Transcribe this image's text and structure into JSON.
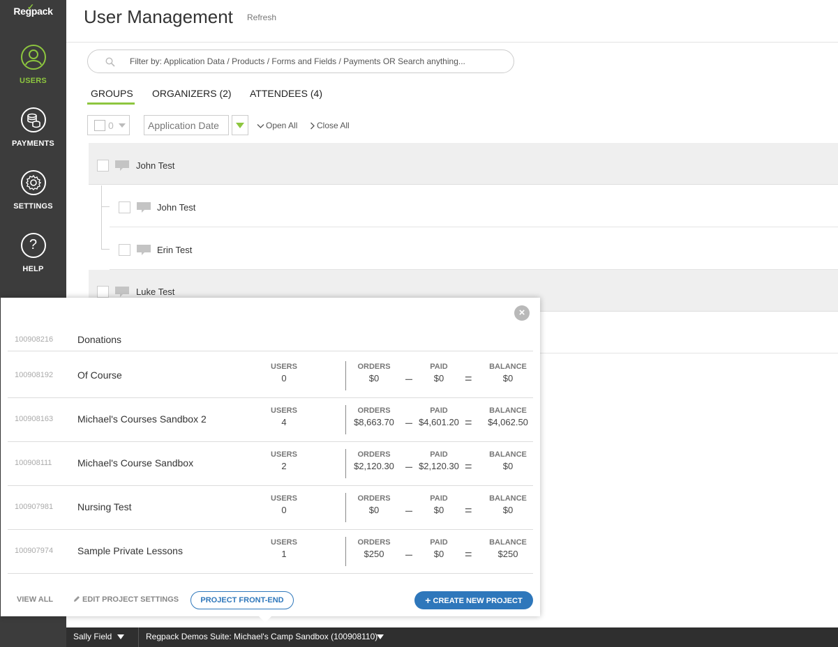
{
  "sidebar": {
    "logo": "Regpack",
    "items": [
      {
        "label": "USERS",
        "icon": "user-icon"
      },
      {
        "label": "PAYMENTS",
        "icon": "coins-icon"
      },
      {
        "label": "SETTINGS",
        "icon": "gear-icon"
      },
      {
        "label": "HELP",
        "icon": "question-icon",
        "glyph": "?"
      }
    ]
  },
  "header": {
    "title": "User Management",
    "refresh": "Refresh"
  },
  "search": {
    "placeholder": "Filter by: Application Data / Products / Forms and Fields / Payments OR Search anything..."
  },
  "tabs": [
    {
      "label": "GROUPS",
      "active": true
    },
    {
      "label": "ORGANIZERS (2)"
    },
    {
      "label": "ATTENDEES (4)"
    }
  ],
  "toolbar": {
    "selected_count": "0",
    "sort_field": "Application Date",
    "open_all": "Open All",
    "close_all": "Close All"
  },
  "groups": [
    {
      "name": "John Test",
      "members": [
        {
          "name": "John Test"
        },
        {
          "name": "Erin Test"
        }
      ]
    },
    {
      "name": "Luke Test",
      "members": []
    }
  ],
  "projects_popup": {
    "close_glyph": "×",
    "labels": {
      "users": "USERS",
      "orders": "ORDERS",
      "paid": "PAID",
      "balance": "BALANCE",
      "minus": "–",
      "equals": "="
    },
    "projects": [
      {
        "id": "100908216",
        "name": "Donations"
      },
      {
        "id": "100908192",
        "name": "Of Course",
        "users": "0",
        "orders": "$0",
        "paid": "$0",
        "balance": "$0"
      },
      {
        "id": "100908163",
        "name": "Michael's Courses Sandbox 2",
        "users": "4",
        "orders": "$8,663.70",
        "paid": "$4,601.20",
        "balance": "$4,062.50"
      },
      {
        "id": "100908111",
        "name": "Michael's Course Sandbox",
        "users": "2",
        "orders": "$2,120.30",
        "paid": "$2,120.30",
        "balance": "$0"
      },
      {
        "id": "100907981",
        "name": "Nursing Test",
        "users": "0",
        "orders": "$0",
        "paid": "$0",
        "balance": "$0"
      },
      {
        "id": "100907974",
        "name": "Sample Private Lessons",
        "users": "1",
        "orders": "$250",
        "paid": "$0",
        "balance": "$250"
      }
    ],
    "footer": {
      "view_all": "VIEW ALL",
      "edit_settings": "EDIT PROJECT SETTINGS",
      "front_end": "PROJECT FRONT-END",
      "create_new": "CREATE NEW PROJECT"
    }
  },
  "bottom_bar": {
    "user": "Sally Field",
    "project": "Regpack Demos Suite: Michael's Camp Sandbox (100908110)"
  },
  "colors": {
    "accent_green": "#8dc63f",
    "primary_blue": "#2e77bb",
    "sidebar_bg": "#3c3c3c"
  }
}
